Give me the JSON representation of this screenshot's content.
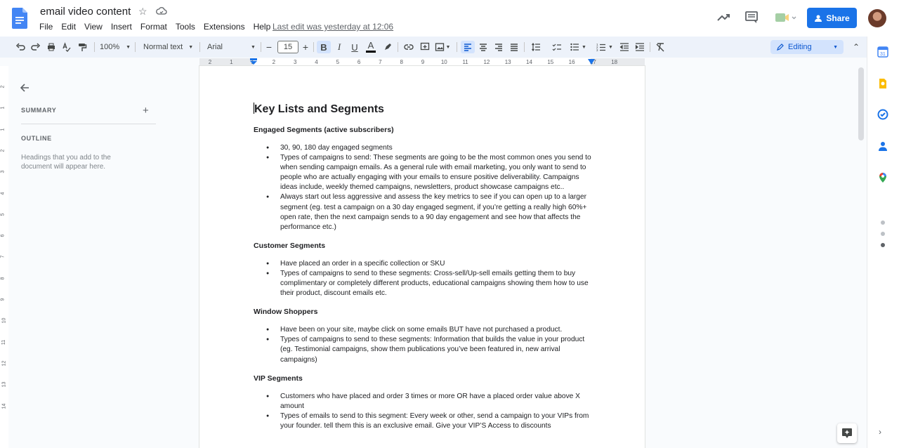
{
  "header": {
    "doc_title": "email video content",
    "last_edit": "Last edit was yesterday at 12:06",
    "share_label": "Share"
  },
  "menu": [
    "File",
    "Edit",
    "View",
    "Insert",
    "Format",
    "Tools",
    "Extensions",
    "Help"
  ],
  "toolbar": {
    "zoom": "100%",
    "style": "Normal text",
    "font": "Arial",
    "font_size": "15",
    "mode": "Editing"
  },
  "ruler": {
    "ticks": [
      "2",
      "1",
      "1",
      "2",
      "3",
      "4",
      "5",
      "6",
      "7",
      "8",
      "9",
      "10",
      "11",
      "12",
      "13",
      "14",
      "15",
      "16",
      "17",
      "18"
    ]
  },
  "vruler": {
    "ticks": [
      "2",
      "1",
      "1",
      "2",
      "3",
      "4",
      "5",
      "6",
      "7",
      "8",
      "9",
      "10",
      "11",
      "12",
      "13",
      "14"
    ]
  },
  "sidebar": {
    "summary": "SUMMARY",
    "outline": "OUTLINE",
    "hint": "Headings that you add to the document will appear here."
  },
  "document": {
    "title": "Key Lists and Segments",
    "sections": [
      {
        "heading": "Engaged Segments (active subscribers)",
        "items": [
          "30, 90, 180 day engaged segments",
          "Types of campaigns to send: These segments are going to be the most common ones you send to when sending campaign emails. As a general rule with email marketing, you only want to send to people who are actually engaging with your emails to ensure positive deliverability. Campaigns ideas include, weekly themed campaigns, newsletters, product showcase campaigns etc..",
          "Always start out less aggressive and assess the key metrics to see if you can open up to a larger segment (eg. test a campaign on a 30 day engaged segment, if you’re getting a really high 60%+ open rate, then the next campaign sends to a 90 day engagement and see how that affects the performance etc.)"
        ]
      },
      {
        "heading": "Customer Segments",
        "items": [
          "Have placed an order in a specific collection or SKU",
          "Types of campaigns to send to these segments: Cross-sell/Up-sell emails getting them to buy complimentary or completely different products, educational campaigns showing them how to use their product, discount emails etc."
        ]
      },
      {
        "heading": "Window Shoppers",
        "items": [
          "Have been on your site, maybe click on some emails BUT have not purchased a product.",
          "Types of campaigns to send to these segments: Information that builds the value in your product (eg. Testimonial campaigns, show them publications you’ve been featured in, new arrival campaigns)"
        ]
      },
      {
        "heading": "VIP Segments",
        "items": [
          "Customers who have placed and order 3 times or more OR have a placed order value above X amount",
          "Types of emails to send to this segment: Every week or other, send a campaign to your VIPs from your founder. tell them this is an exclusive email. Give your VIP’S Access to discounts"
        ]
      }
    ]
  },
  "colors": {
    "share": "#1a73e8",
    "toolbar_bg": "#edf2fa",
    "active": "#d3e3fd"
  }
}
